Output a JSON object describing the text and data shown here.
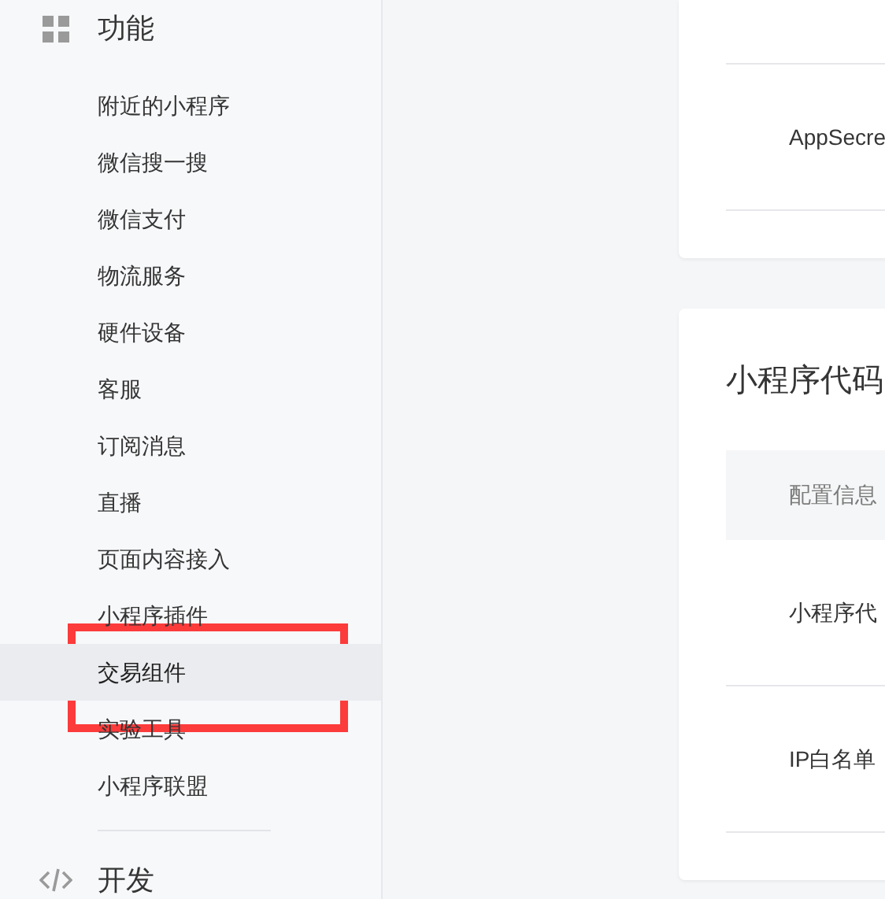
{
  "sidebar": {
    "section": {
      "title": "功能"
    },
    "items": [
      {
        "label": "附近的小程序",
        "selected": false,
        "highlighted": false
      },
      {
        "label": "微信搜一搜",
        "selected": false,
        "highlighted": false
      },
      {
        "label": "微信支付",
        "selected": false,
        "highlighted": false
      },
      {
        "label": "物流服务",
        "selected": false,
        "highlighted": false
      },
      {
        "label": "硬件设备",
        "selected": false,
        "highlighted": false
      },
      {
        "label": "客服",
        "selected": false,
        "highlighted": false
      },
      {
        "label": "订阅消息",
        "selected": false,
        "highlighted": false
      },
      {
        "label": "直播",
        "selected": false,
        "highlighted": false
      },
      {
        "label": "页面内容接入",
        "selected": false,
        "highlighted": false
      },
      {
        "label": "小程序插件",
        "selected": false,
        "highlighted": false
      },
      {
        "label": "交易组件",
        "selected": true,
        "highlighted": true
      },
      {
        "label": "实验工具",
        "selected": false,
        "highlighted": false
      },
      {
        "label": "小程序联盟",
        "selected": false,
        "highlighted": false
      }
    ],
    "next_section": {
      "title": "开发"
    }
  },
  "cards": [
    {
      "rows": [
        "AppSecre"
      ]
    },
    {
      "title": "小程序代码",
      "header": "配置信息",
      "rows": [
        "小程序代",
        "IP白名单"
      ]
    }
  ]
}
